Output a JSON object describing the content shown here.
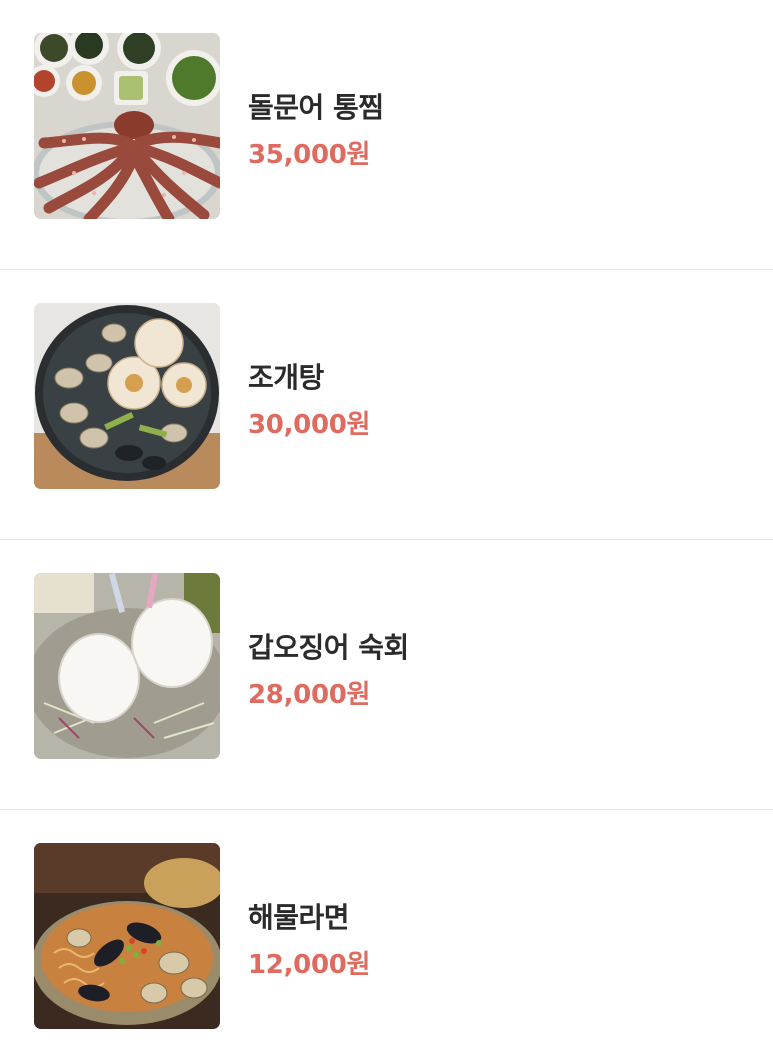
{
  "menu": {
    "items": [
      {
        "name": "돌문어 통찜",
        "price": "35,000원",
        "image_icon": "steamed-octopus-photo"
      },
      {
        "name": "조개탕",
        "price": "30,000원",
        "image_icon": "clam-soup-photo"
      },
      {
        "name": "갑오징어 숙회",
        "price": "28,000원",
        "image_icon": "cuttlefish-photo"
      },
      {
        "name": "해물라면",
        "price": "12,000원",
        "image_icon": "seafood-ramen-photo"
      }
    ]
  },
  "colors": {
    "price": "#df6a5f",
    "name": "#2b2b2b",
    "divider": "#e6e6e6",
    "background": "#ffffff"
  }
}
